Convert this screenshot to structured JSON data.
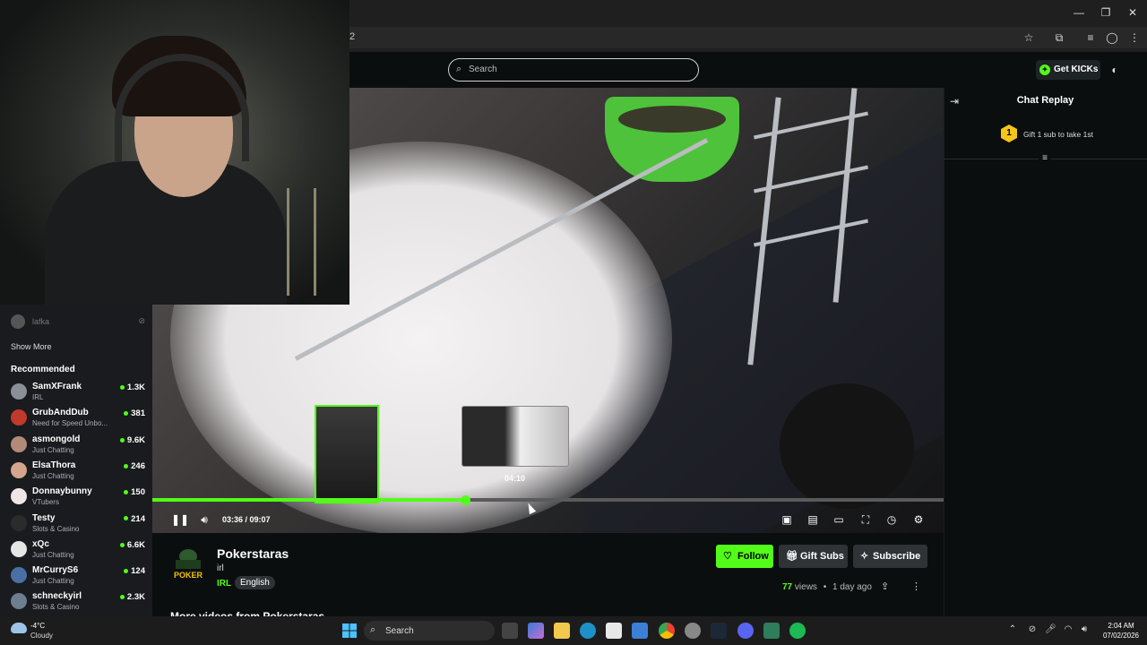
{
  "browser": {
    "address_text": "2",
    "window_controls": [
      "minimize",
      "restore",
      "close"
    ]
  },
  "header": {
    "search_placeholder": "Search",
    "get_kicks_label": "Get KICKs"
  },
  "sidebar": {
    "followed": [
      {
        "name": "lafka"
      }
    ],
    "show_more_label": "Show More",
    "recommended_label": "Recommended",
    "recommended": [
      {
        "name": "SamXFrank",
        "category": "IRL",
        "viewers": "1.3K",
        "color": "#8a8f98"
      },
      {
        "name": "GrubAndDub",
        "category": "Need for Speed Unbo...",
        "viewers": "381",
        "color": "#c0392b"
      },
      {
        "name": "asmongold",
        "category": "Just Chatting",
        "viewers": "9.6K",
        "color": "#b38a7a"
      },
      {
        "name": "ElsaThora",
        "category": "Just Chatting",
        "viewers": "246",
        "color": "#d4a58c"
      },
      {
        "name": "Donnaybunny",
        "category": "VTubers",
        "viewers": "150",
        "color": "#f0e6e6"
      },
      {
        "name": "Testy",
        "category": "Slots & Casino",
        "viewers": "214",
        "color": "#2b2b2b"
      },
      {
        "name": "xQc",
        "category": "Just Chatting",
        "viewers": "6.6K",
        "color": "#e6e6e6"
      },
      {
        "name": "MrCurryS6",
        "category": "Just Chatting",
        "viewers": "124",
        "color": "#4a6fa5"
      },
      {
        "name": "schneckyirl",
        "category": "Slots & Casino",
        "viewers": "2.3K",
        "color": "#6d7f8f"
      }
    ]
  },
  "player": {
    "current_time": "03:36",
    "duration": "09:07",
    "time_display": "03:36 / 09:07",
    "hover_time": "04:10",
    "progress_fraction": 0.395,
    "accent": "#53fc18"
  },
  "channel": {
    "name": "Pokerstaras",
    "title": "irl",
    "category": "IRL",
    "language": "English",
    "logo_text": "POKER",
    "follow_label": "Follow",
    "gift_subs_label": "Gift Subs",
    "subscribe_label": "Subscribe",
    "views_count": "77",
    "views_label": "views",
    "uploaded": "1 day ago",
    "more_videos_label": "More videos from Pokerstaras"
  },
  "chat": {
    "title": "Chat Replay",
    "gift_rank": "1",
    "gift_text": "Gift 1 sub to take 1st"
  },
  "taskbar": {
    "weather_temp": "-4°C",
    "weather_desc": "Cloudy",
    "search_label": "Search",
    "time": "2:04 AM",
    "date": "07/02/2026"
  }
}
